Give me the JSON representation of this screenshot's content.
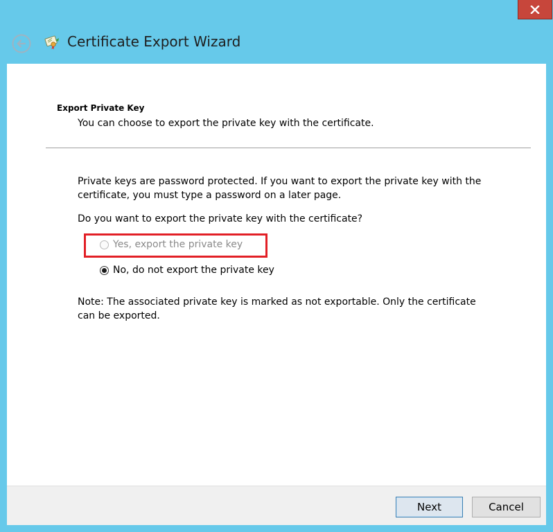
{
  "window": {
    "title": "Certificate Export Wizard",
    "close_symbol": "x"
  },
  "icons": {
    "back": "back-arrow-icon",
    "wizard": "certificate-icon",
    "close": "close-icon"
  },
  "colors": {
    "titlebar": "#66c9ea",
    "close_button": "#c7463b",
    "highlight_box": "#e21f26",
    "disabled_text": "#8a8a8a"
  },
  "page": {
    "heading": "Export Private Key",
    "description": "You can choose to export the private key with the certificate.",
    "info_line1": "Private keys are password protected. If you want to export the private key with the",
    "info_line2": "certificate, you must type a password on a later page.",
    "question": "Do you want to export the private key with the certificate?",
    "options": [
      {
        "label": "Yes, export the private key",
        "selected": false,
        "enabled": false
      },
      {
        "label": "No, do not export the private key",
        "selected": true,
        "enabled": true
      }
    ],
    "note_line1": "Note: The associated private key is marked as not exportable. Only the certificate",
    "note_line2": "can be exported."
  },
  "footer": {
    "next_label": "Next",
    "cancel_label": "Cancel"
  }
}
